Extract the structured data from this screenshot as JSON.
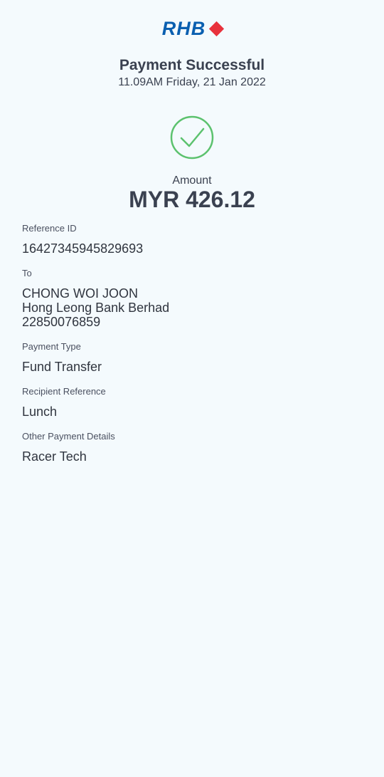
{
  "header": {
    "logo_text": "RHB"
  },
  "status": {
    "title": "Payment Successful",
    "datetime": "11.09AM Friday, 21 Jan 2022"
  },
  "amount": {
    "label": "Amount",
    "value": "MYR 426.12"
  },
  "details": {
    "reference_id": {
      "label": "Reference ID",
      "value": "16427345945829693"
    },
    "to": {
      "label": "To",
      "name": "CHONG WOI JOON",
      "bank": "Hong Leong Bank Berhad",
      "account": "22850076859"
    },
    "payment_type": {
      "label": "Payment Type",
      "value": "Fund Transfer"
    },
    "recipient_reference": {
      "label": "Recipient Reference",
      "value": "Lunch"
    },
    "other_payment_details": {
      "label": "Other Payment Details",
      "value": "Racer Tech"
    }
  },
  "colors": {
    "brand_blue": "#0a5fb0",
    "brand_red": "#e8323c",
    "success_green": "#5cc26e",
    "background": "#f4fafd"
  },
  "icons": {
    "success": "check-circle-icon",
    "logo_mark": "diamond-icon"
  }
}
